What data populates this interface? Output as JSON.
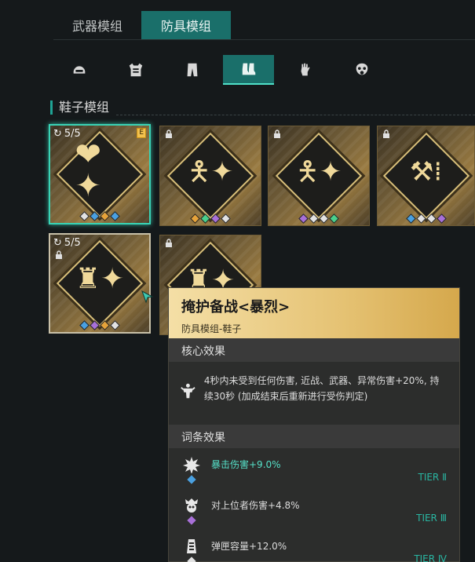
{
  "top_tabs": [
    {
      "label": "武器模组",
      "active": false
    },
    {
      "label": "防具模组",
      "active": true
    }
  ],
  "categories": [
    {
      "icon": "helmet-icon",
      "active": false
    },
    {
      "icon": "armor-vest-icon",
      "active": false
    },
    {
      "icon": "pants-icon",
      "active": false
    },
    {
      "icon": "boots-icon",
      "active": true
    },
    {
      "icon": "gloves-icon",
      "active": false
    },
    {
      "icon": "gas-mask-icon",
      "active": false
    }
  ],
  "section": {
    "title": "鞋子模组"
  },
  "mods": [
    {
      "badge": "5/5",
      "icon": "heart-burst-icon",
      "selected": true,
      "tag": "E",
      "dots": [
        "#e2e2e2",
        "#4aa0e0",
        "#e6a33a",
        "#4aa0e0"
      ]
    },
    {
      "locked": true,
      "icon": "rifleman-icon",
      "dots": [
        "#e6a33a",
        "#4ad08c",
        "#a870d8",
        "#e2e2e2"
      ]
    },
    {
      "locked": true,
      "icon": "rifleman-icon",
      "dots": [
        "#a870d8",
        "#e2e2e2",
        "#e2e2e2",
        "#4ad08c"
      ]
    },
    {
      "locked": true,
      "icon": "pickaxe-ammo-icon",
      "dots": [
        "#4aa0e0",
        "#e2e2e2",
        "#e2e2e2",
        "#a870d8"
      ]
    },
    {
      "badge": "5/5",
      "icon": "flexing-body-icon",
      "outline": true,
      "dots": [
        "#4aa0e0",
        "#a870d8",
        "#e6a33a",
        "#e2e2e2"
      ]
    },
    {
      "locked": true,
      "icon": "flexing-body-icon",
      "dots": []
    }
  ],
  "tooltip": {
    "title": "掩护备战<暴烈>",
    "subtitle": "防具模组-鞋子",
    "core_header": "核心效果",
    "core_text": "4秒内未受到任何伤害, 近战、武器、异常伤害+20%, 持续30秒 (加成结束后重新进行受伤判定)",
    "affix_header": "词条效果",
    "affixes": [
      {
        "label": "暴击伤害+9.0%",
        "tier": "TIER Ⅱ",
        "dot": "#4aa0e0",
        "icon": "explosion-icon",
        "highlight": true
      },
      {
        "label": "对上位者伤害+4.8%",
        "tier": "TIER Ⅲ",
        "dot": "#a870d8",
        "icon": "skull-crown-icon",
        "highlight": false
      },
      {
        "label": "弹匣容量+12.0%",
        "tier": "TIER Ⅳ",
        "dot": "#e2e2e2",
        "icon": "magazine-icon",
        "highlight": false
      }
    ]
  }
}
